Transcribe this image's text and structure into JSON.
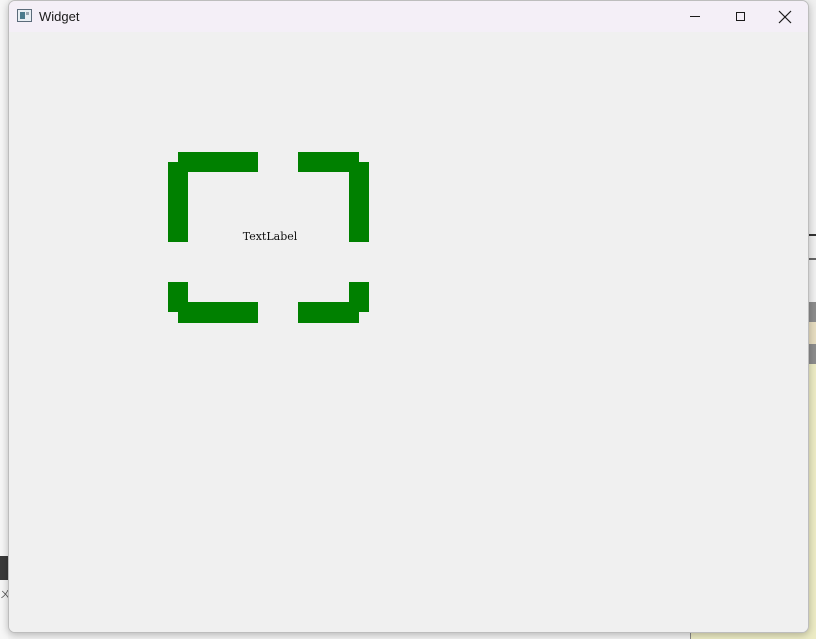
{
  "window": {
    "title": "Widget",
    "buttons": {
      "minimize": "minimize-icon",
      "maximize": "maximize-icon",
      "close": "close-icon"
    }
  },
  "content": {
    "label_text": "TextLabel",
    "frame_color": "#008000"
  },
  "background": {
    "left_glyph": "ㄨ"
  }
}
